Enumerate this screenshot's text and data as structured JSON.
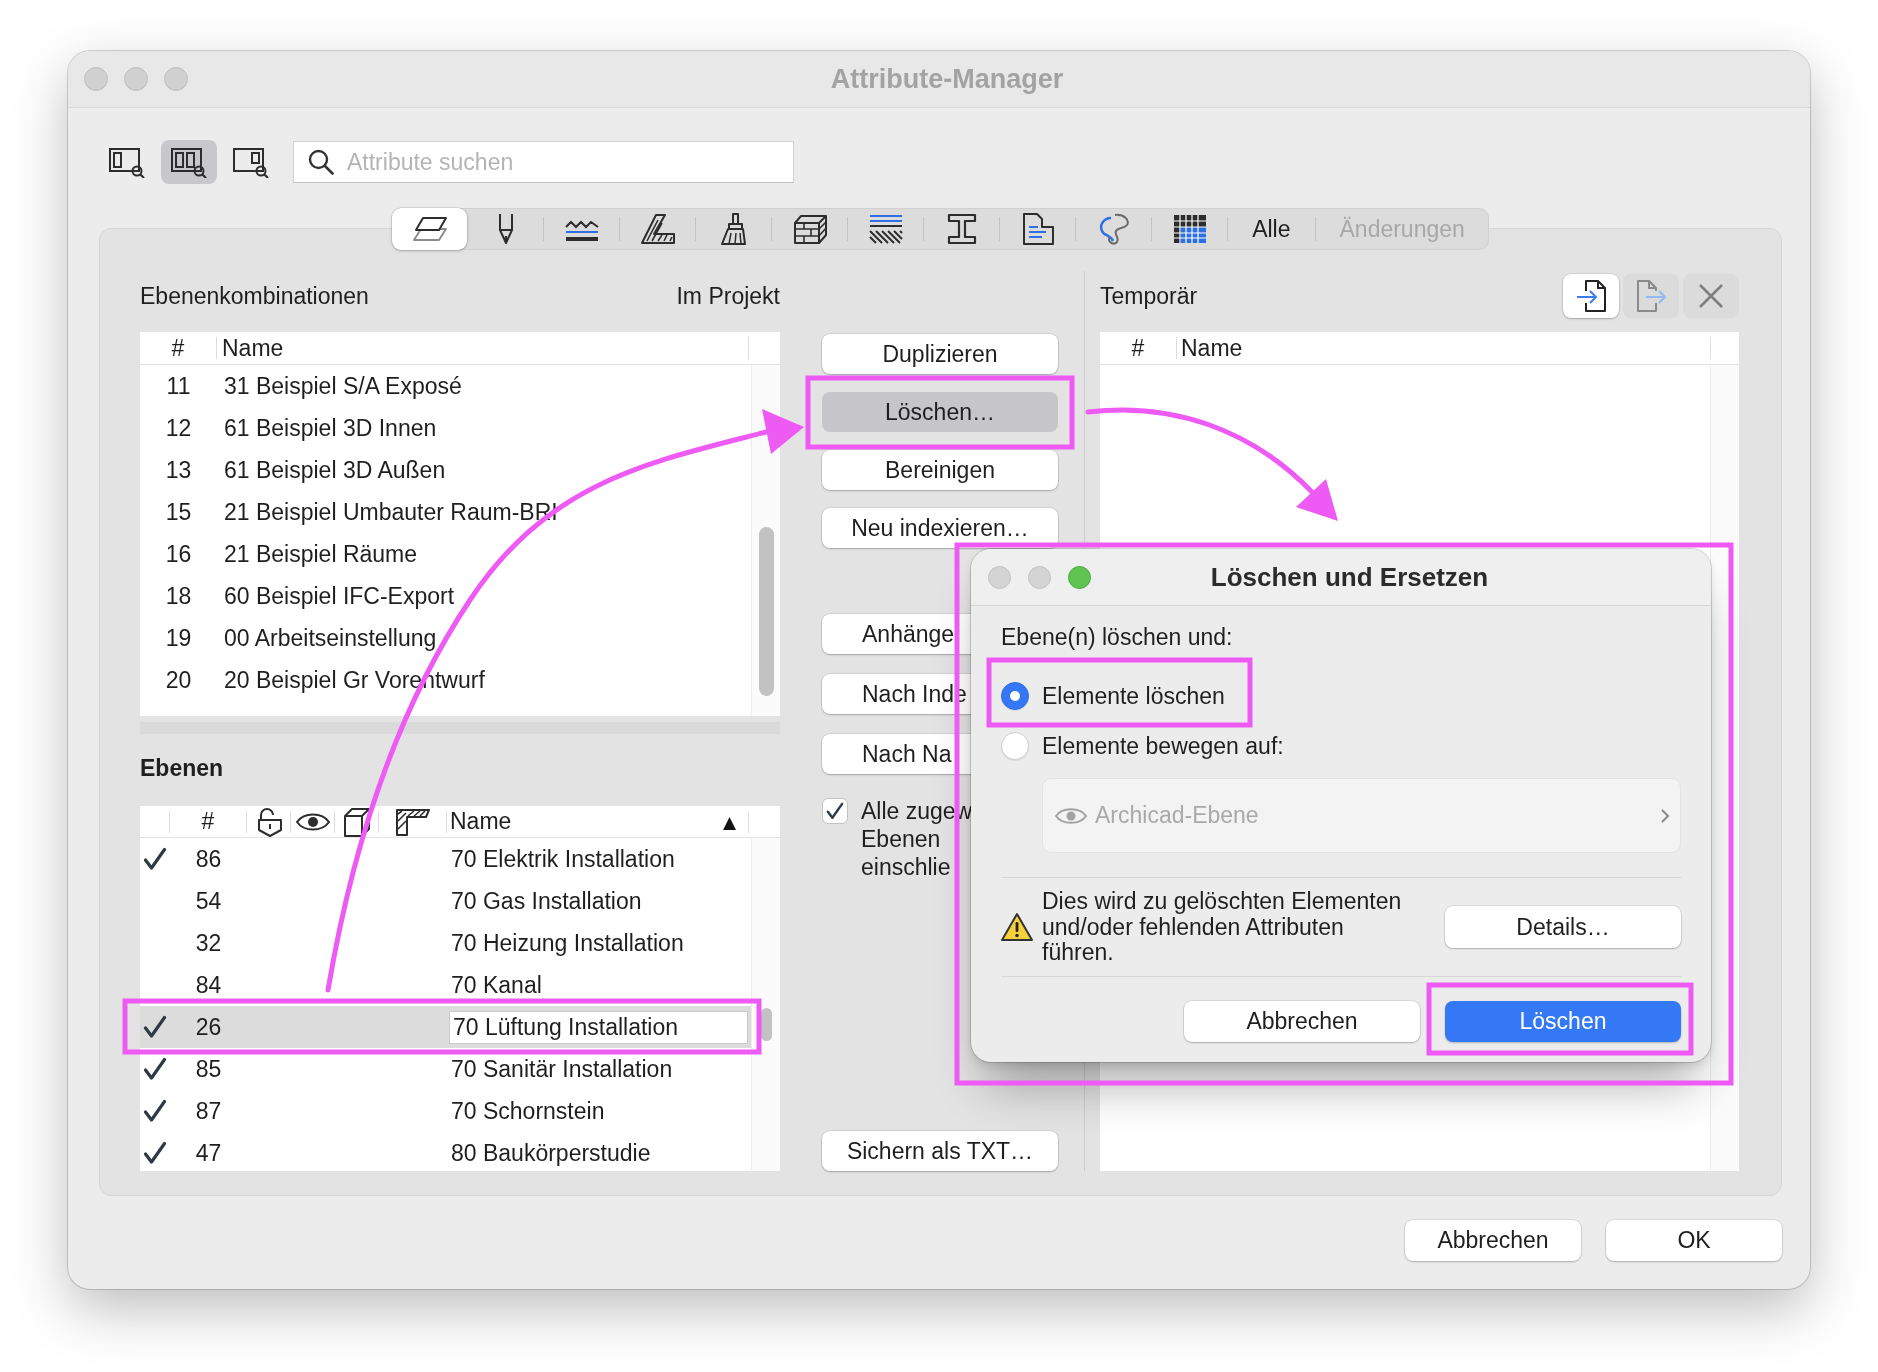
{
  "window": {
    "title": "Attribute-Manager"
  },
  "toolbar": {
    "view_buttons": [
      {
        "selected": false
      },
      {
        "selected": true
      },
      {
        "selected": false
      }
    ],
    "search": {
      "placeholder": "Attribute suchen"
    }
  },
  "attribute_tabs": [
    {
      "kind": "icon",
      "selected": true
    },
    {
      "kind": "icon",
      "selected": false
    },
    {
      "kind": "icon",
      "selected": false
    },
    {
      "kind": "icon",
      "selected": false
    },
    {
      "kind": "icon",
      "selected": false
    },
    {
      "kind": "icon",
      "selected": false
    },
    {
      "kind": "icon",
      "selected": false
    },
    {
      "kind": "icon",
      "selected": false
    },
    {
      "kind": "icon",
      "selected": false
    },
    {
      "kind": "icon",
      "selected": false
    },
    {
      "kind": "icon",
      "selected": false
    },
    {
      "kind": "text",
      "label": "Alle",
      "selected": false,
      "disabled": false
    },
    {
      "kind": "text",
      "label": "Änderungen",
      "selected": false,
      "disabled": true
    }
  ],
  "combinations_panel": {
    "title": "Ebenenkombinationen",
    "scope_label": "Im Projekt",
    "table": {
      "columns": [
        "#",
        "Name"
      ],
      "rows": [
        {
          "number": "11",
          "name": "31 Beispiel S/A Exposé"
        },
        {
          "number": "12",
          "name": "61 Beispiel 3D Innen"
        },
        {
          "number": "13",
          "name": "61 Beispiel 3D Außen"
        },
        {
          "number": "15",
          "name": "21 Beispiel Umbauter Raum-BRI"
        },
        {
          "number": "16",
          "name": "21 Beispiel Räume"
        },
        {
          "number": "18",
          "name": "60 Beispiel IFC-Export"
        },
        {
          "number": "19",
          "name": "00 Arbeitseinstellung"
        },
        {
          "number": "20",
          "name": "20 Beispiel Gr Vorentwurf"
        }
      ]
    }
  },
  "layers_panel": {
    "title": "Ebenen",
    "table": {
      "columns": [
        {
          "kind": "check"
        },
        {
          "kind": "text",
          "label": "#"
        },
        {
          "kind": "icon"
        },
        {
          "kind": "icon"
        },
        {
          "kind": "icon"
        },
        {
          "kind": "icon"
        },
        {
          "kind": "text",
          "label": "Name",
          "sort_indicator": "▲"
        }
      ],
      "rows": [
        {
          "checked": true,
          "number": "86",
          "name": "70 Elektrik Installation",
          "selected": false,
          "editing": false
        },
        {
          "checked": false,
          "number": "54",
          "name": "70 Gas Installation",
          "selected": false,
          "editing": false
        },
        {
          "checked": false,
          "number": "32",
          "name": "70 Heizung Installation",
          "selected": false,
          "editing": false
        },
        {
          "checked": false,
          "number": "84",
          "name": "70 Kanal",
          "selected": false,
          "editing": false
        },
        {
          "checked": true,
          "number": "26",
          "name": "70 Lüftung Installation",
          "selected": true,
          "editing": true
        },
        {
          "checked": true,
          "number": "85",
          "name": "70 Sanitär Installation",
          "selected": false,
          "editing": false
        },
        {
          "checked": true,
          "number": "87",
          "name": "70 Schornstein",
          "selected": false,
          "editing": false
        },
        {
          "checked": true,
          "number": "47",
          "name": "80 Baukörperstudie",
          "selected": false,
          "editing": false
        }
      ]
    }
  },
  "actions": {
    "edit_buttons": [
      {
        "label": "Duplizieren",
        "pressed": false
      },
      {
        "label": "Löschen…",
        "pressed": true
      },
      {
        "label": "Bereinigen",
        "pressed": false
      },
      {
        "label": "Neu indexieren…",
        "pressed": false
      }
    ],
    "sort_buttons": [
      {
        "label": "Anhänge"
      },
      {
        "label": "Nach Inde"
      },
      {
        "label": "Nach Na"
      }
    ],
    "include_all": {
      "label": "Alle zugew\nEbenen\neinschlie",
      "checked": true
    },
    "export_button": {
      "label": "Sichern als TXT…"
    }
  },
  "temporary_panel": {
    "title": "Temporär",
    "tool_buttons": [
      {
        "disabled": false
      },
      {
        "disabled": true
      },
      {
        "disabled": true
      }
    ],
    "table": {
      "columns": [
        "#",
        "Name"
      ]
    }
  },
  "dialog": {
    "title": "Löschen und Ersetzen",
    "prompt": "Ebene(n) löschen und:",
    "options": [
      {
        "label": "Elemente löschen",
        "selected": true
      },
      {
        "label": "Elemente bewegen auf:",
        "selected": false
      }
    ],
    "target_layer": {
      "value": "Archicad-Ebene",
      "disabled": true
    },
    "warning": "Dies wird zu gelöschten Elementen und/oder fehlenden Attributen führen.",
    "details_button": "Details…",
    "buttons": [
      {
        "label": "Abbrechen",
        "kind": "secondary"
      },
      {
        "label": "Löschen",
        "kind": "primary"
      }
    ]
  },
  "footer_buttons": [
    "Abbrechen",
    "OK"
  ]
}
